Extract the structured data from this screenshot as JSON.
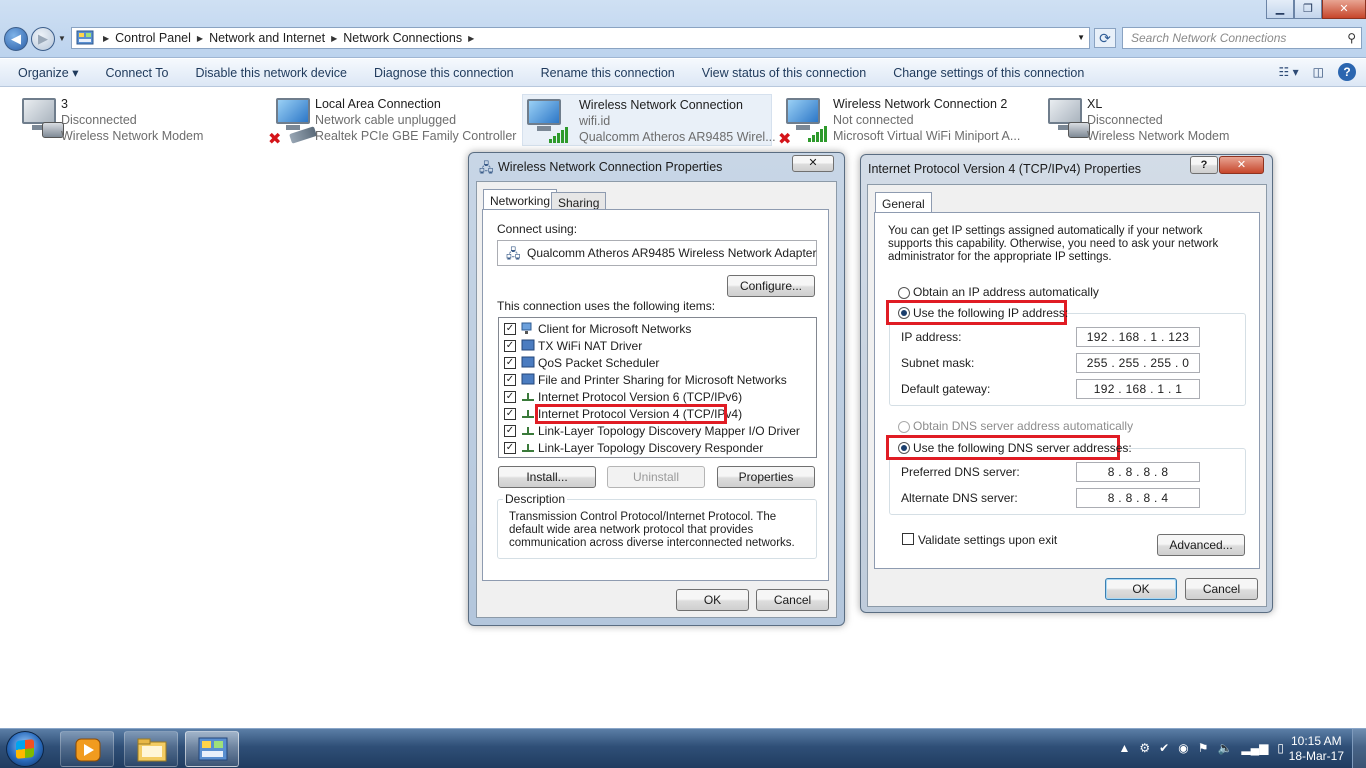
{
  "address": {
    "crumbs": [
      "Control Panel",
      "Network and Internet",
      "Network Connections"
    ],
    "search_placeholder": "Search Network Connections"
  },
  "commands": {
    "organize": "Organize ▾",
    "items": [
      "Connect To",
      "Disable this network device",
      "Diagnose this connection",
      "Rename this connection",
      "View status of this connection",
      "Change settings of this connection"
    ]
  },
  "connections": [
    {
      "name": "3",
      "status": "Disconnected",
      "device": "Wireless Network Modem"
    },
    {
      "name": "Local Area Connection",
      "status": "Network cable unplugged",
      "device": "Realtek PCIe GBE Family Controller"
    },
    {
      "name": "Wireless Network Connection",
      "status": "wifi.id",
      "device": "Qualcomm Atheros AR9485 Wirel..."
    },
    {
      "name": "Wireless Network Connection 2",
      "status": "Not connected",
      "device": "Microsoft Virtual WiFi Miniport A..."
    },
    {
      "name": "XL",
      "status": "Disconnected",
      "device": "Wireless Network Modem"
    }
  ],
  "props_dialog": {
    "title": "Wireless Network Connection Properties",
    "tabs": [
      "Networking",
      "Sharing"
    ],
    "connect_using_label": "Connect using:",
    "adapter": "Qualcomm Atheros AR9485 Wireless Network Adapter",
    "configure": "Configure...",
    "items_label": "This connection uses the following items:",
    "items": [
      "Client for Microsoft Networks",
      "TX WiFi NAT Driver",
      "QoS Packet Scheduler",
      "File and Printer Sharing for Microsoft Networks",
      "Internet Protocol Version 6 (TCP/IPv6)",
      "Internet Protocol Version 4 (TCP/IPv4)",
      "Link-Layer Topology Discovery Mapper I/O Driver",
      "Link-Layer Topology Discovery Responder"
    ],
    "install": "Install...",
    "uninstall": "Uninstall",
    "properties": "Properties",
    "description_label": "Description",
    "description": "Transmission Control Protocol/Internet Protocol. The default wide area network protocol that provides communication across diverse interconnected networks.",
    "ok": "OK",
    "cancel": "Cancel"
  },
  "ipv4_dialog": {
    "title": "Internet Protocol Version 4 (TCP/IPv4) Properties",
    "help": "?",
    "close": "✕",
    "tab": "General",
    "intro": "You can get IP settings assigned automatically if your network supports this capability. Otherwise, you need to ask your network administrator for the appropriate IP settings.",
    "obtain_ip": "Obtain an IP address automatically",
    "use_ip": "Use the following IP address:",
    "ip_label": "IP address:",
    "ip": "192  .  168  .   1   .  123",
    "mask_label": "Subnet mask:",
    "mask": "255  .  255  .  255  .   0",
    "gw_label": "Default gateway:",
    "gw": "192  .  168  .   1   .   1",
    "obtain_dns": "Obtain DNS server address automatically",
    "use_dns": "Use the following DNS server addresses:",
    "pref_label": "Preferred DNS server:",
    "pref": "8   .   8   .   8   .   8",
    "alt_label": "Alternate DNS server:",
    "alt": "8   .   8   .   8   .   4",
    "validate": "Validate settings upon exit",
    "advanced": "Advanced...",
    "ok": "OK",
    "cancel": "Cancel"
  },
  "taskbar": {
    "time": "10:15 AM",
    "date": "18-Mar-17"
  }
}
